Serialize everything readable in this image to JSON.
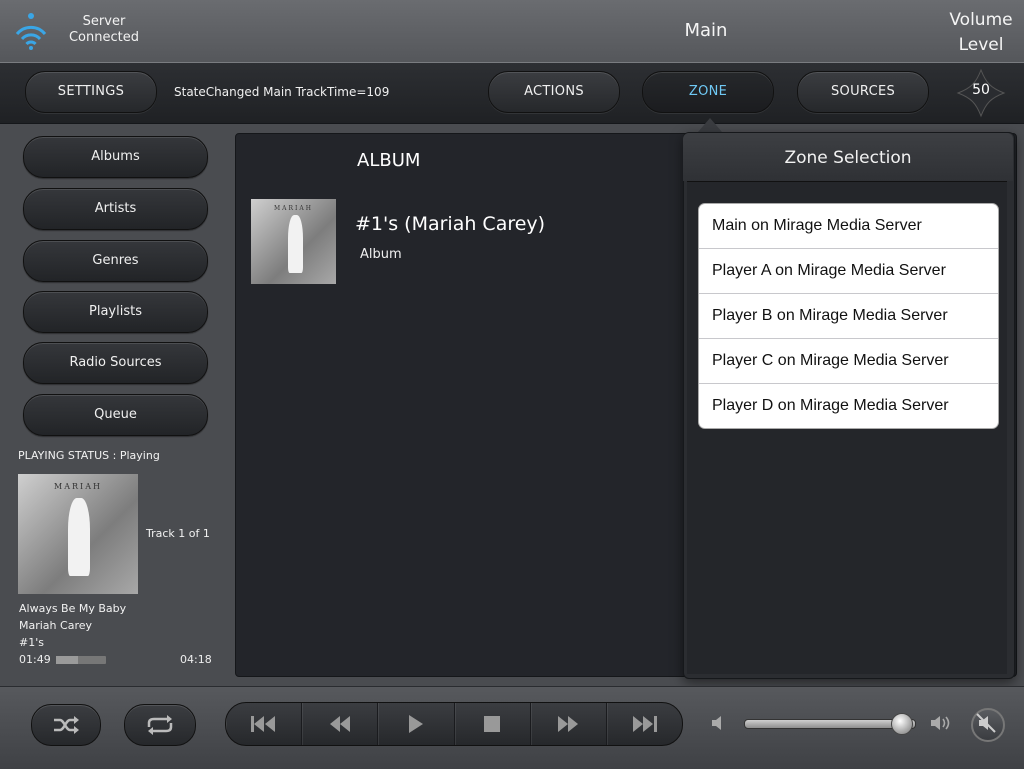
{
  "server": {
    "status_line1": "Server",
    "status_line2": "Connected",
    "icon": "wifi-icon"
  },
  "zone_title": "Main",
  "volume": {
    "title_line1": "Volume",
    "title_line2": "Level",
    "value": "50",
    "level": 0.93
  },
  "nav": {
    "settings": "SETTINGS",
    "status_message": "StateChanged Main TrackTime=109",
    "actions": "ACTIONS",
    "zone": "ZONE",
    "sources": "SOURCES"
  },
  "sidebar": {
    "items": [
      {
        "label": "Albums"
      },
      {
        "label": "Artists"
      },
      {
        "label": "Genres"
      },
      {
        "label": "Playlists"
      },
      {
        "label": "Radio Sources"
      },
      {
        "label": "Queue"
      }
    ]
  },
  "now_playing": {
    "status": "PLAYING STATUS : Playing",
    "cover_brand": "MARIAH",
    "track_count": "Track 1 of 1",
    "title": "Always Be My Baby",
    "artist": "Mariah Carey",
    "album": "#1's",
    "elapsed": "01:49",
    "remaining": "04:18",
    "progress": 0.44
  },
  "content": {
    "header": "ALBUM",
    "result": {
      "cover_brand": "MARIAH",
      "title": "#1's (Mariah Carey)",
      "type": "Album"
    }
  },
  "zone_popover": {
    "title": "Zone Selection",
    "zones": [
      "Main on Mirage Media Server",
      "Player A on Mirage Media Server",
      "Player B on Mirage Media Server",
      "Player C on Mirage Media Server",
      "Player D on Mirage Media Server"
    ]
  },
  "colors": {
    "accent": "#6fc9f5",
    "wifi": "#3aa6e6"
  }
}
